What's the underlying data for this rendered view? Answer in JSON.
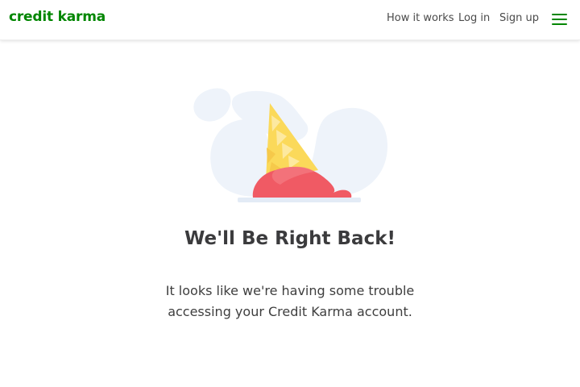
{
  "header": {
    "logo_text": "credit karma",
    "nav": {
      "how_it_works": "How it works",
      "log_in": "Log in",
      "sign_up": "Sign up"
    },
    "menu_icon": "hamburger-menu-icon"
  },
  "illustration": {
    "icon": "fallen-ice-cream-cone-icon"
  },
  "main": {
    "title": "We'll Be Right Back!",
    "message": "It looks like we're having some trouble accessing your Credit Karma account."
  },
  "colors": {
    "brand_green": "#008600",
    "text_dark": "#3b3b3d",
    "cloud_blue": "#eef3fa",
    "cone_yellow": "#fbd95a",
    "scoop_red": "#f05a64"
  }
}
